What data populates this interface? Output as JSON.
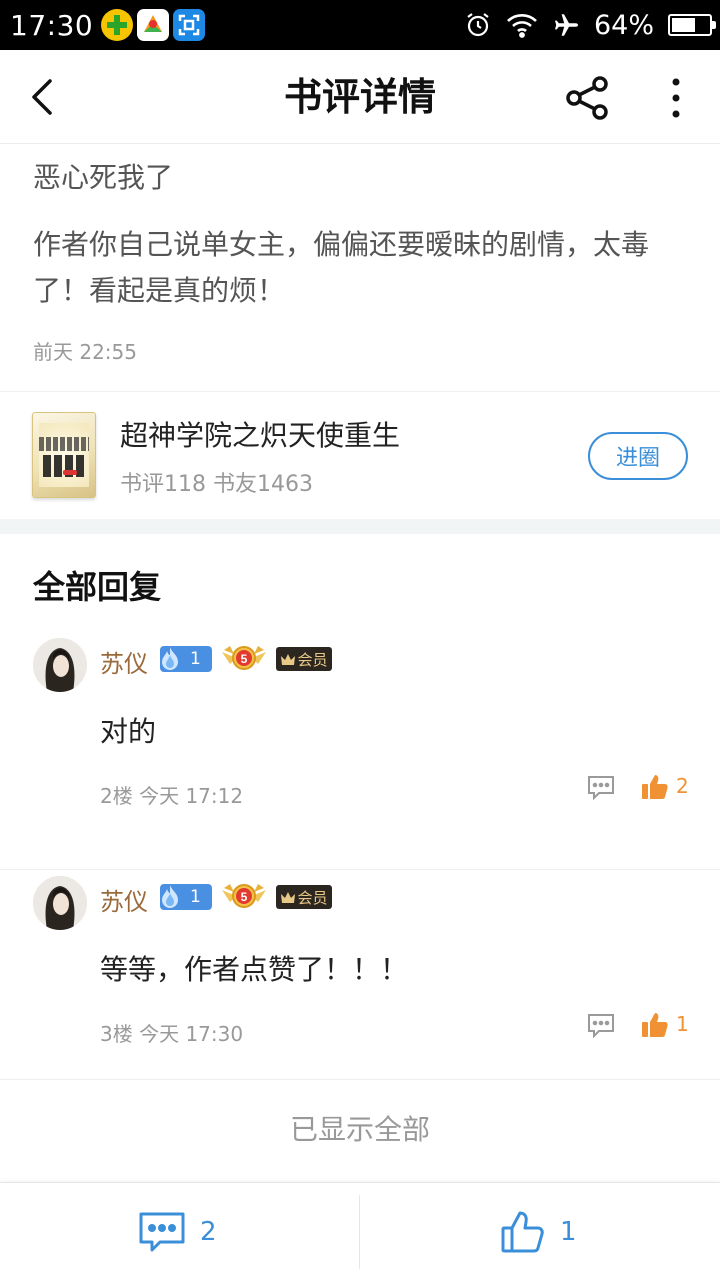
{
  "status_bar": {
    "time": "17:30",
    "battery_percent": "64%",
    "battery_level": 0.64
  },
  "header": {
    "title": "书评详情"
  },
  "review": {
    "title": "恶心死我了",
    "body": "作者你自己说单女主，偏偏还要暧昧的剧情，太毒了！看起是真的烦！",
    "time": "前天 22:55"
  },
  "book": {
    "name": "超神学院之炽天使重生",
    "stats": "书评118 书友1463",
    "join_label": "进圈"
  },
  "replies_section": {
    "title": "全部回复",
    "items": [
      {
        "user": "苏仪",
        "level": "1",
        "rank": "5",
        "vip": "会员",
        "text": "对的",
        "meta": "2楼 今天 17:12",
        "likes": "2"
      },
      {
        "user": "苏仪",
        "level": "1",
        "rank": "5",
        "vip": "会员",
        "text": "等等，作者点赞了！！！",
        "meta": "3楼 今天 17:30",
        "likes": "1"
      }
    ],
    "footer": "已显示全部"
  },
  "bottom_bar": {
    "comment_count": "2",
    "like_count": "1"
  },
  "colors": {
    "accent": "#3b8fd8",
    "like_orange": "#f09234",
    "username": "#9a6a3d"
  }
}
